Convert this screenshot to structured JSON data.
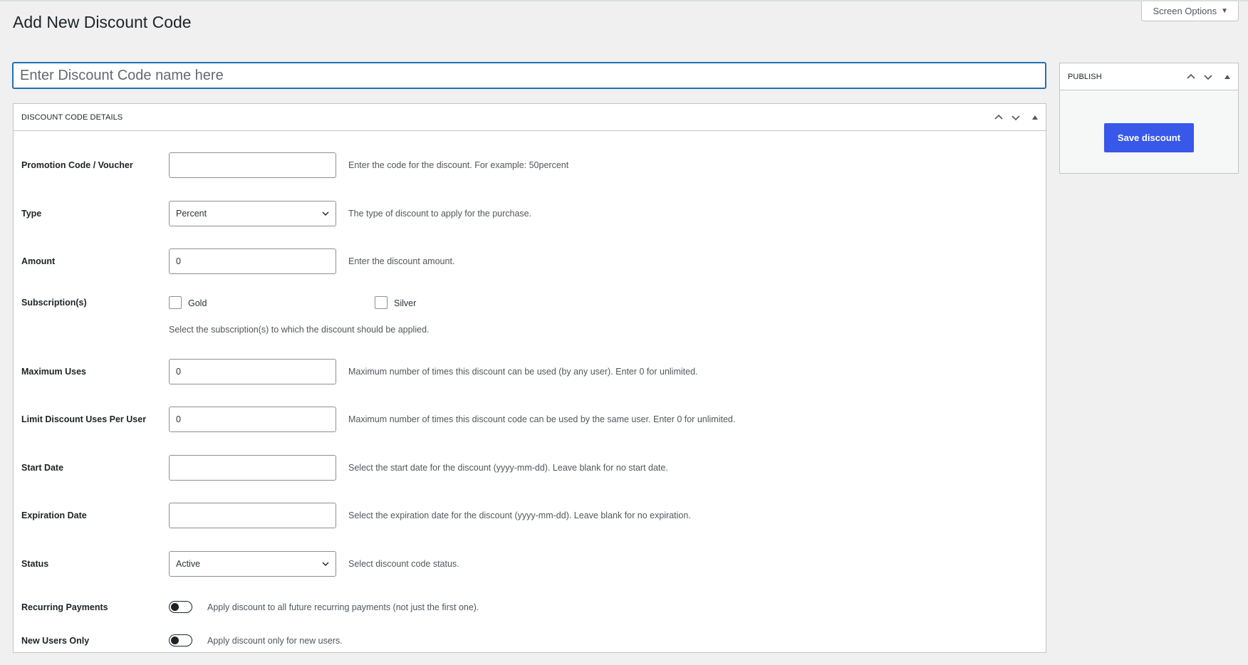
{
  "header": {
    "title": "Add New Discount Code",
    "screen_options_label": "Screen Options"
  },
  "title_input": {
    "placeholder": "Enter Discount Code name here",
    "value": ""
  },
  "details_box": {
    "title": "Discount Code Details",
    "fields": {
      "promo_code": {
        "label": "Promotion Code / Voucher",
        "value": "",
        "description": "Enter the code for the discount. For example: 50percent"
      },
      "type": {
        "label": "Type",
        "value": "Percent",
        "description": "The type of discount to apply for the purchase."
      },
      "amount": {
        "label": "Amount",
        "value": "0",
        "description": "Enter the discount amount."
      },
      "subscriptions": {
        "label": "Subscription(s)",
        "options": [
          {
            "label": "Gold",
            "checked": false
          },
          {
            "label": "Silver",
            "checked": false
          }
        ],
        "description": "Select the subscription(s) to which the discount should be applied."
      },
      "max_uses": {
        "label": "Maximum Uses",
        "value": "0",
        "description": "Maximum number of times this discount can be used (by any user). Enter 0 for unlimited."
      },
      "limit_per_user": {
        "label": "Limit Discount Uses Per User",
        "value": "0",
        "description": "Maximum number of times this discount code can be used by the same user. Enter 0 for unlimited."
      },
      "start_date": {
        "label": "Start Date",
        "value": "",
        "description": "Select the start date for the discount (yyyy-mm-dd). Leave blank for no start date."
      },
      "expiration_date": {
        "label": "Expiration Date",
        "value": "",
        "description": "Select the expiration date for the discount (yyyy-mm-dd). Leave blank for no expiration."
      },
      "status": {
        "label": "Status",
        "value": "Active",
        "description": "Select discount code status."
      },
      "recurring": {
        "label": "Recurring Payments",
        "enabled": false,
        "description": "Apply discount to all future recurring payments (not just the first one)."
      },
      "new_users_only": {
        "label": "New Users Only",
        "enabled": false,
        "description": "Apply discount only for new users."
      }
    }
  },
  "publish_box": {
    "title": "Publish",
    "save_label": "Save discount"
  },
  "colors": {
    "primary_button": "#3858e9",
    "focus_border": "#2271b1",
    "background": "#f0f0f1"
  }
}
